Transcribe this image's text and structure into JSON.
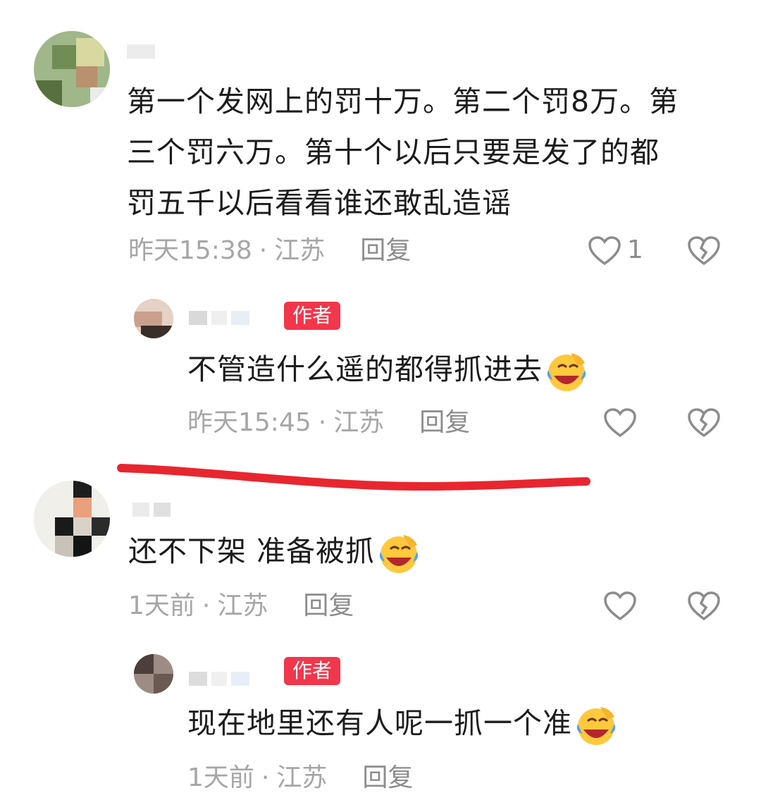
{
  "comments": [
    {
      "text": "第一个发网上的罚十万。第二个罚8万。第三个罚六万。第十个以后只要是发了的都罚五千以后看看谁还敢乱造谣",
      "line1": "第一个发网上的罚十万。第二个罚8万。第",
      "line2": "三个罚六万。第十个以后只要是发了的都",
      "line3": "罚五千以后看看谁还敢乱造谣",
      "time": "昨天15:38",
      "location": "江苏",
      "reply_label": "回复",
      "like_count": "1"
    },
    {
      "author_tag": "作者",
      "text": "不管造什么遥的都得抓进去",
      "time": "昨天15:45",
      "location": "江苏",
      "reply_label": "回复"
    },
    {
      "text": "还不下架 准备被抓",
      "time": "1天前",
      "location": "江苏",
      "reply_label": "回复"
    },
    {
      "author_tag": "作者",
      "text": "现在地里还有人呢一抓一个准",
      "time": "1天前",
      "location": "江苏",
      "reply_label": "回复"
    }
  ],
  "separator": "·",
  "colors": {
    "author_tag_bg": "#f2364b",
    "meta_text": "#a6a6a6",
    "annotation_line": "#e8262f"
  },
  "icons": [
    "like-icon",
    "dislike-icon",
    "laughing-crying-emoji"
  ]
}
